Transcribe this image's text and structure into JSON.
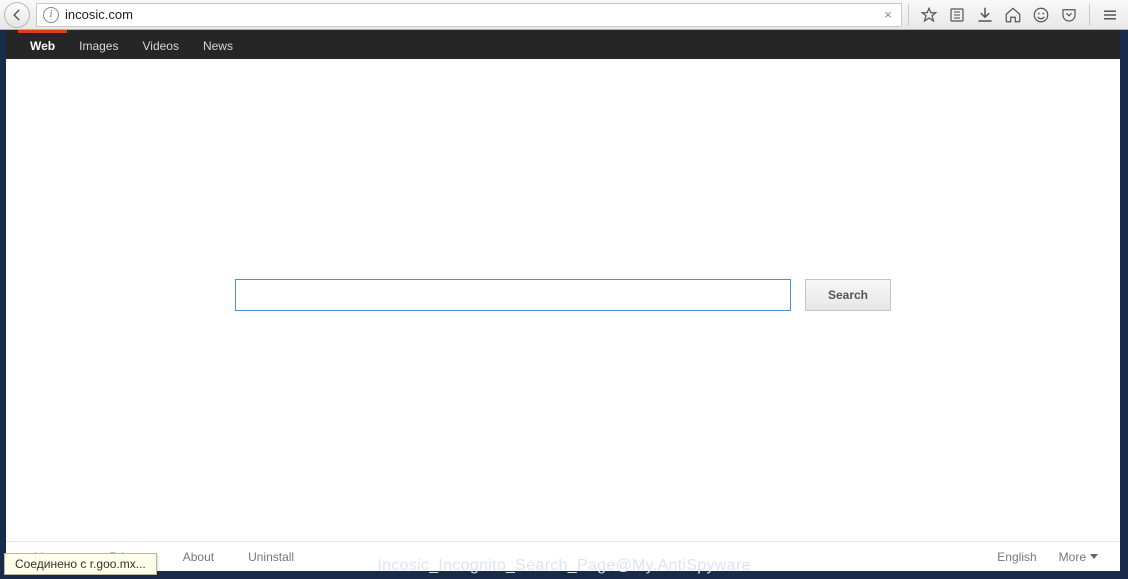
{
  "browser": {
    "url_display": "incosic.com",
    "info_glyph": "i",
    "clear_glyph": "×"
  },
  "topnav": {
    "items": [
      {
        "label": "Web",
        "active": true
      },
      {
        "label": "Images",
        "active": false
      },
      {
        "label": "Videos",
        "active": false
      },
      {
        "label": "News",
        "active": false
      }
    ]
  },
  "search": {
    "value": "",
    "button_label": "Search"
  },
  "footer": {
    "left": [
      "License",
      "Privacy",
      "About",
      "Uninstall"
    ],
    "right_language": "English",
    "right_more": "More"
  },
  "status_tooltip": "Соединено с r.goo.mx...",
  "watermark": "Incosic_Incognito_Search_Page@My.AntiSpyware"
}
